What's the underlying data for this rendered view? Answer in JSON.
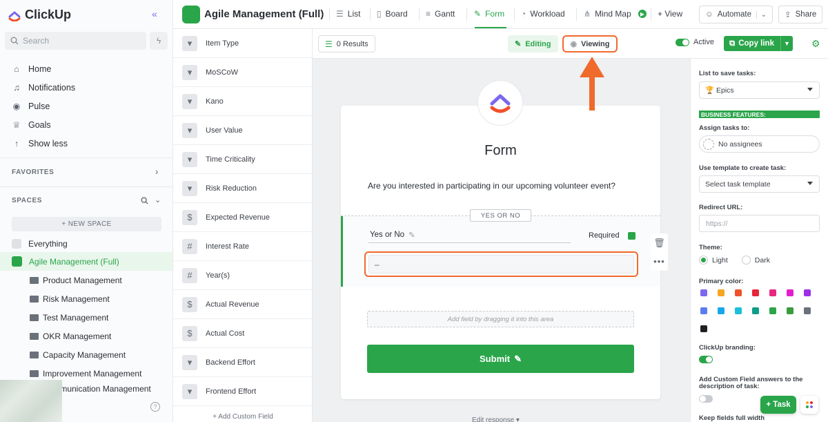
{
  "app": {
    "name": "ClickUp"
  },
  "sidebar": {
    "search_placeholder": "Search",
    "nav": [
      {
        "label": "Home",
        "icon": "home-icon"
      },
      {
        "label": "Notifications",
        "icon": "bell-icon"
      },
      {
        "label": "Pulse",
        "icon": "pulse-icon"
      },
      {
        "label": "Goals",
        "icon": "trophy-icon"
      },
      {
        "label": "Show less",
        "icon": "arrow-up-icon"
      }
    ],
    "favorites_label": "FAVORITES",
    "spaces_label": "SPACES",
    "new_space_label": "+ NEW SPACE",
    "everything_label": "Everything",
    "active_space": "Agile Management (Full)",
    "folders": [
      "Product Management",
      "Risk Management",
      "Test Management",
      "OKR Management",
      "Capacity Management",
      "Improvement Management",
      "Communication Management"
    ]
  },
  "topbar": {
    "title": "Agile Management (Full)",
    "tabs": [
      {
        "label": "List",
        "icon": "list-icon"
      },
      {
        "label": "Board",
        "icon": "board-icon"
      },
      {
        "label": "Gantt",
        "icon": "gantt-icon"
      },
      {
        "label": "Form",
        "icon": "form-icon",
        "active": true
      },
      {
        "label": "Workload",
        "icon": "gauge-icon"
      },
      {
        "label": "Mind Map",
        "icon": "mindmap-icon"
      }
    ],
    "add_view": "+ View",
    "automate": "Automate",
    "share": "Share"
  },
  "fields": [
    {
      "label": "Item Type",
      "type": "dropdown"
    },
    {
      "label": "MoSCoW",
      "type": "dropdown"
    },
    {
      "label": "Kano",
      "type": "dropdown"
    },
    {
      "label": "User Value",
      "type": "dropdown"
    },
    {
      "label": "Time Criticality",
      "type": "dropdown"
    },
    {
      "label": "Risk Reduction",
      "type": "dropdown"
    },
    {
      "label": "Expected Revenue",
      "type": "currency"
    },
    {
      "label": "Interest Rate",
      "type": "number"
    },
    {
      "label": "Year(s)",
      "type": "number"
    },
    {
      "label": "Actual Revenue",
      "type": "currency"
    },
    {
      "label": "Actual Cost",
      "type": "currency"
    },
    {
      "label": "Backend Effort",
      "type": "dropdown"
    },
    {
      "label": "Frontend Effort",
      "type": "dropdown"
    }
  ],
  "add_custom_field": "+ Add Custom Field",
  "formbar": {
    "results": "0 Results",
    "editing": "Editing",
    "viewing": "Viewing",
    "active": "Active",
    "copy_link": "Copy link"
  },
  "form": {
    "title": "Form",
    "question": "Are you interested in participating in our upcoming volunteer event?",
    "field_tag": "YES OR NO",
    "field_label": "Yes or No",
    "required": "Required",
    "input_value": "–",
    "drop_hint": "Add field by dragging it into this area",
    "submit": "Submit",
    "edit_response": "Edit response ▾"
  },
  "settings": {
    "list_label": "List to save tasks:",
    "list_value": "🏆 Epics",
    "business_badge": "BUSINESS FEATURES:",
    "assign_label": "Assign tasks to:",
    "assign_value": "No assignees",
    "template_label": "Use template to create task:",
    "template_value": "Select task template",
    "redirect_label": "Redirect URL:",
    "redirect_placeholder": "https://",
    "theme_label": "Theme:",
    "theme_light": "Light",
    "theme_dark": "Dark",
    "primary_color_label": "Primary color:",
    "colors": [
      "#7b68ee",
      "#f5a623",
      "#f0512b",
      "#e5253b",
      "#e8277f",
      "#e11ecf",
      "#9b30e8",
      "#5b7cf0",
      "#17a7e8",
      "#18c0d8",
      "#0f9d8a",
      "#2aa54a",
      "#3a9b3e",
      "#6b717a",
      "#1f2023"
    ],
    "branding_label": "ClickUp branding:",
    "custom_answers_label": "Add Custom Field answers to the description of task:",
    "keep_fields_label": "Keep fields full width"
  },
  "fab": {
    "task": "+ Task"
  }
}
